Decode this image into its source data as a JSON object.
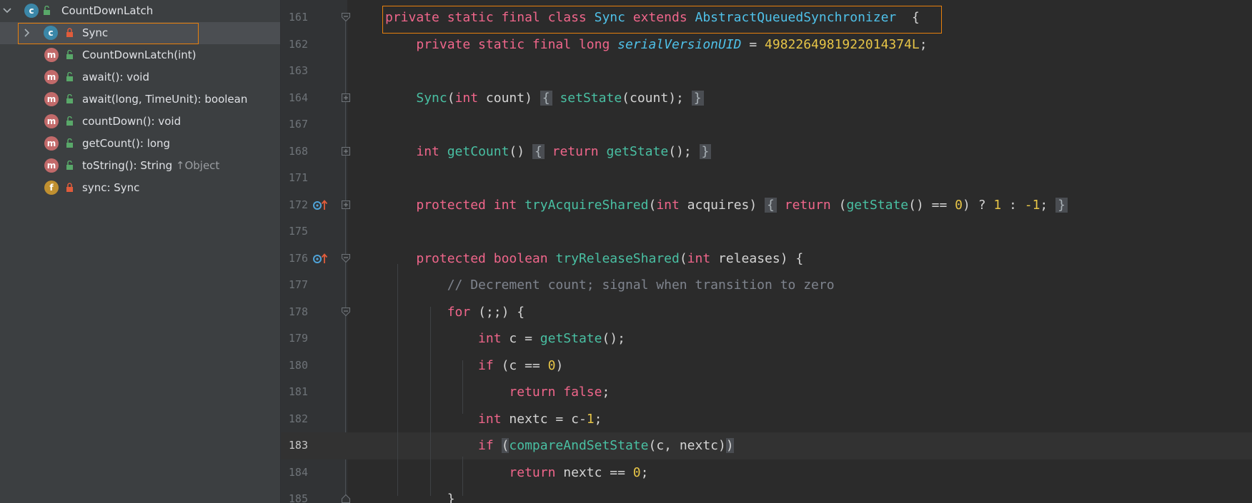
{
  "structure": {
    "root": {
      "label": "CountDownLatch",
      "icon": "class-icon"
    },
    "items": [
      {
        "label": "Sync",
        "icon": "class-icon",
        "selected": true,
        "access": "private"
      },
      {
        "label": "CountDownLatch(int)",
        "icon": "method-icon",
        "access": "public"
      },
      {
        "label": "await(): void",
        "icon": "method-icon",
        "access": "public"
      },
      {
        "label": "await(long, TimeUnit): boolean",
        "icon": "method-icon",
        "access": "public"
      },
      {
        "label": "countDown(): void",
        "icon": "method-icon",
        "access": "public"
      },
      {
        "label": "getCount(): long",
        "icon": "method-icon",
        "access": "public"
      },
      {
        "label": "toString(): String",
        "inherit": "↑Object",
        "icon": "method-icon",
        "access": "public"
      },
      {
        "label": "sync: Sync",
        "icon": "field-icon",
        "access": "private"
      }
    ]
  },
  "editor": {
    "current_line": "183",
    "lines": [
      {
        "num": "161",
        "tokens": [
          [
            "kw",
            "private static final class "
          ],
          [
            "ty",
            "Sync "
          ],
          [
            "kw",
            "extends "
          ],
          [
            "ty",
            "AbstractQueuedSynchronizer"
          ],
          [
            "",
            "  {"
          ]
        ]
      },
      {
        "num": "162",
        "tokens": [
          [
            "",
            "    "
          ],
          [
            "kw",
            "private static final long "
          ],
          [
            "it",
            "serialVersionUID"
          ],
          [
            "",
            " = "
          ],
          [
            "num",
            "4982264981922014374L"
          ],
          [
            "",
            ";"
          ]
        ]
      },
      {
        "num": "163",
        "tokens": []
      },
      {
        "num": "164",
        "tokens": [
          [
            "",
            "    "
          ],
          [
            "fn",
            "Sync"
          ],
          [
            "",
            "("
          ],
          [
            "kw",
            "int "
          ],
          [
            "",
            "count) "
          ],
          [
            "fold",
            "{"
          ],
          [
            "fn",
            " setState"
          ],
          [
            "",
            "(count); "
          ],
          [
            "fold",
            "}"
          ]
        ]
      },
      {
        "num": "167",
        "tokens": []
      },
      {
        "num": "168",
        "tokens": [
          [
            "",
            "    "
          ],
          [
            "kw",
            "int "
          ],
          [
            "fn",
            "getCount"
          ],
          [
            "",
            "() "
          ],
          [
            "fold",
            "{"
          ],
          [
            "kw",
            " return "
          ],
          [
            "fn",
            "getState"
          ],
          [
            "",
            "(); "
          ],
          [
            "fold",
            "}"
          ]
        ]
      },
      {
        "num": "171",
        "tokens": []
      },
      {
        "num": "172",
        "tokens": [
          [
            "",
            "    "
          ],
          [
            "kw",
            "protected int "
          ],
          [
            "fn",
            "tryAcquireShared"
          ],
          [
            "",
            "("
          ],
          [
            "kw",
            "int "
          ],
          [
            "",
            "acquires) "
          ],
          [
            "fold",
            "{"
          ],
          [
            "kw",
            " return "
          ],
          [
            "",
            "("
          ],
          [
            "fn",
            "getState"
          ],
          [
            "",
            "() == "
          ],
          [
            "num",
            "0"
          ],
          [
            "",
            ") ? "
          ],
          [
            "num",
            "1"
          ],
          [
            "",
            " : "
          ],
          [
            "num",
            "-1"
          ],
          [
            "",
            "; "
          ],
          [
            "fold",
            "}"
          ]
        ]
      },
      {
        "num": "175",
        "tokens": []
      },
      {
        "num": "176",
        "tokens": [
          [
            "",
            "    "
          ],
          [
            "kw",
            "protected boolean "
          ],
          [
            "fn",
            "tryReleaseShared"
          ],
          [
            "",
            "("
          ],
          [
            "kw",
            "int "
          ],
          [
            "",
            "releases) {"
          ]
        ]
      },
      {
        "num": "177",
        "tokens": [
          [
            "",
            "        "
          ],
          [
            "cm",
            "// Decrement count; signal when transition to zero"
          ]
        ]
      },
      {
        "num": "178",
        "tokens": [
          [
            "",
            "        "
          ],
          [
            "kw",
            "for "
          ],
          [
            "",
            "(;;) {"
          ]
        ]
      },
      {
        "num": "179",
        "tokens": [
          [
            "",
            "            "
          ],
          [
            "kw",
            "int "
          ],
          [
            "",
            "c = "
          ],
          [
            "fn",
            "getState"
          ],
          [
            "",
            "();"
          ]
        ]
      },
      {
        "num": "180",
        "tokens": [
          [
            "",
            "            "
          ],
          [
            "kw",
            "if "
          ],
          [
            "",
            "(c == "
          ],
          [
            "num",
            "0"
          ],
          [
            "",
            ")"
          ]
        ]
      },
      {
        "num": "181",
        "tokens": [
          [
            "",
            "                "
          ],
          [
            "kw",
            "return false"
          ],
          [
            "",
            ";"
          ]
        ]
      },
      {
        "num": "182",
        "tokens": [
          [
            "",
            "            "
          ],
          [
            "kw",
            "int "
          ],
          [
            "",
            "nextc = c-"
          ],
          [
            "num",
            "1"
          ],
          [
            "",
            ";"
          ]
        ]
      },
      {
        "num": "183",
        "tokens": [
          [
            "",
            "            "
          ],
          [
            "kw",
            "if "
          ],
          [
            "match",
            "("
          ],
          [
            "fn",
            "compareAndSetState"
          ],
          [
            "",
            "(c, nextc)"
          ],
          [
            "match",
            ")"
          ]
        ]
      },
      {
        "num": "184",
        "tokens": [
          [
            "",
            "                "
          ],
          [
            "kw",
            "return "
          ],
          [
            "",
            "nextc == "
          ],
          [
            "num",
            "0"
          ],
          [
            "",
            ";"
          ]
        ]
      },
      {
        "num": "185",
        "tokens": [
          [
            "",
            "        }"
          ]
        ]
      }
    ]
  }
}
